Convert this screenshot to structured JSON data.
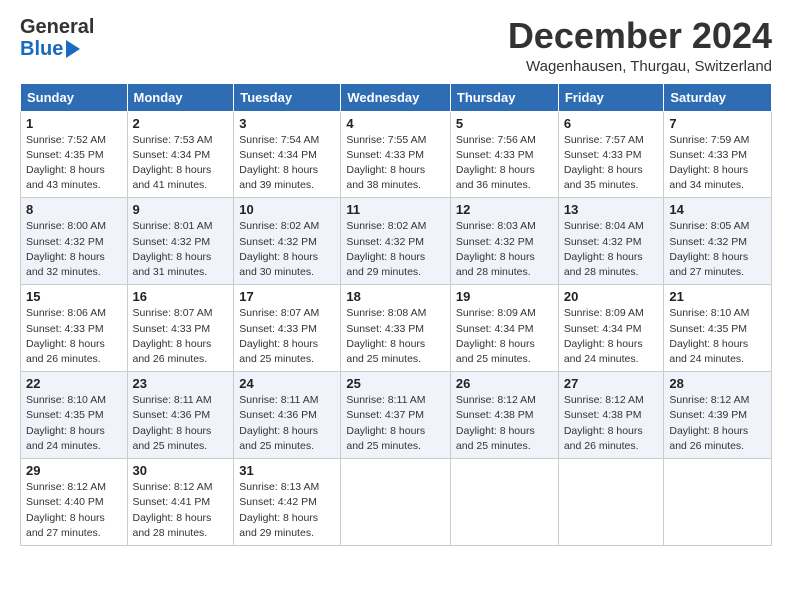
{
  "header": {
    "logo_general": "General",
    "logo_blue": "Blue",
    "title": "December 2024",
    "subtitle": "Wagenhausen, Thurgau, Switzerland"
  },
  "columns": [
    "Sunday",
    "Monday",
    "Tuesday",
    "Wednesday",
    "Thursday",
    "Friday",
    "Saturday"
  ],
  "weeks": [
    [
      {
        "day": "1",
        "sunrise": "Sunrise: 7:52 AM",
        "sunset": "Sunset: 4:35 PM",
        "daylight": "Daylight: 8 hours and 43 minutes."
      },
      {
        "day": "2",
        "sunrise": "Sunrise: 7:53 AM",
        "sunset": "Sunset: 4:34 PM",
        "daylight": "Daylight: 8 hours and 41 minutes."
      },
      {
        "day": "3",
        "sunrise": "Sunrise: 7:54 AM",
        "sunset": "Sunset: 4:34 PM",
        "daylight": "Daylight: 8 hours and 39 minutes."
      },
      {
        "day": "4",
        "sunrise": "Sunrise: 7:55 AM",
        "sunset": "Sunset: 4:33 PM",
        "daylight": "Daylight: 8 hours and 38 minutes."
      },
      {
        "day": "5",
        "sunrise": "Sunrise: 7:56 AM",
        "sunset": "Sunset: 4:33 PM",
        "daylight": "Daylight: 8 hours and 36 minutes."
      },
      {
        "day": "6",
        "sunrise": "Sunrise: 7:57 AM",
        "sunset": "Sunset: 4:33 PM",
        "daylight": "Daylight: 8 hours and 35 minutes."
      },
      {
        "day": "7",
        "sunrise": "Sunrise: 7:59 AM",
        "sunset": "Sunset: 4:33 PM",
        "daylight": "Daylight: 8 hours and 34 minutes."
      }
    ],
    [
      {
        "day": "8",
        "sunrise": "Sunrise: 8:00 AM",
        "sunset": "Sunset: 4:32 PM",
        "daylight": "Daylight: 8 hours and 32 minutes."
      },
      {
        "day": "9",
        "sunrise": "Sunrise: 8:01 AM",
        "sunset": "Sunset: 4:32 PM",
        "daylight": "Daylight: 8 hours and 31 minutes."
      },
      {
        "day": "10",
        "sunrise": "Sunrise: 8:02 AM",
        "sunset": "Sunset: 4:32 PM",
        "daylight": "Daylight: 8 hours and 30 minutes."
      },
      {
        "day": "11",
        "sunrise": "Sunrise: 8:02 AM",
        "sunset": "Sunset: 4:32 PM",
        "daylight": "Daylight: 8 hours and 29 minutes."
      },
      {
        "day": "12",
        "sunrise": "Sunrise: 8:03 AM",
        "sunset": "Sunset: 4:32 PM",
        "daylight": "Daylight: 8 hours and 28 minutes."
      },
      {
        "day": "13",
        "sunrise": "Sunrise: 8:04 AM",
        "sunset": "Sunset: 4:32 PM",
        "daylight": "Daylight: 8 hours and 28 minutes."
      },
      {
        "day": "14",
        "sunrise": "Sunrise: 8:05 AM",
        "sunset": "Sunset: 4:32 PM",
        "daylight": "Daylight: 8 hours and 27 minutes."
      }
    ],
    [
      {
        "day": "15",
        "sunrise": "Sunrise: 8:06 AM",
        "sunset": "Sunset: 4:33 PM",
        "daylight": "Daylight: 8 hours and 26 minutes."
      },
      {
        "day": "16",
        "sunrise": "Sunrise: 8:07 AM",
        "sunset": "Sunset: 4:33 PM",
        "daylight": "Daylight: 8 hours and 26 minutes."
      },
      {
        "day": "17",
        "sunrise": "Sunrise: 8:07 AM",
        "sunset": "Sunset: 4:33 PM",
        "daylight": "Daylight: 8 hours and 25 minutes."
      },
      {
        "day": "18",
        "sunrise": "Sunrise: 8:08 AM",
        "sunset": "Sunset: 4:33 PM",
        "daylight": "Daylight: 8 hours and 25 minutes."
      },
      {
        "day": "19",
        "sunrise": "Sunrise: 8:09 AM",
        "sunset": "Sunset: 4:34 PM",
        "daylight": "Daylight: 8 hours and 25 minutes."
      },
      {
        "day": "20",
        "sunrise": "Sunrise: 8:09 AM",
        "sunset": "Sunset: 4:34 PM",
        "daylight": "Daylight: 8 hours and 24 minutes."
      },
      {
        "day": "21",
        "sunrise": "Sunrise: 8:10 AM",
        "sunset": "Sunset: 4:35 PM",
        "daylight": "Daylight: 8 hours and 24 minutes."
      }
    ],
    [
      {
        "day": "22",
        "sunrise": "Sunrise: 8:10 AM",
        "sunset": "Sunset: 4:35 PM",
        "daylight": "Daylight: 8 hours and 24 minutes."
      },
      {
        "day": "23",
        "sunrise": "Sunrise: 8:11 AM",
        "sunset": "Sunset: 4:36 PM",
        "daylight": "Daylight: 8 hours and 25 minutes."
      },
      {
        "day": "24",
        "sunrise": "Sunrise: 8:11 AM",
        "sunset": "Sunset: 4:36 PM",
        "daylight": "Daylight: 8 hours and 25 minutes."
      },
      {
        "day": "25",
        "sunrise": "Sunrise: 8:11 AM",
        "sunset": "Sunset: 4:37 PM",
        "daylight": "Daylight: 8 hours and 25 minutes."
      },
      {
        "day": "26",
        "sunrise": "Sunrise: 8:12 AM",
        "sunset": "Sunset: 4:38 PM",
        "daylight": "Daylight: 8 hours and 25 minutes."
      },
      {
        "day": "27",
        "sunrise": "Sunrise: 8:12 AM",
        "sunset": "Sunset: 4:38 PM",
        "daylight": "Daylight: 8 hours and 26 minutes."
      },
      {
        "day": "28",
        "sunrise": "Sunrise: 8:12 AM",
        "sunset": "Sunset: 4:39 PM",
        "daylight": "Daylight: 8 hours and 26 minutes."
      }
    ],
    [
      {
        "day": "29",
        "sunrise": "Sunrise: 8:12 AM",
        "sunset": "Sunset: 4:40 PM",
        "daylight": "Daylight: 8 hours and 27 minutes."
      },
      {
        "day": "30",
        "sunrise": "Sunrise: 8:12 AM",
        "sunset": "Sunset: 4:41 PM",
        "daylight": "Daylight: 8 hours and 28 minutes."
      },
      {
        "day": "31",
        "sunrise": "Sunrise: 8:13 AM",
        "sunset": "Sunset: 4:42 PM",
        "daylight": "Daylight: 8 hours and 29 minutes."
      },
      null,
      null,
      null,
      null
    ]
  ]
}
